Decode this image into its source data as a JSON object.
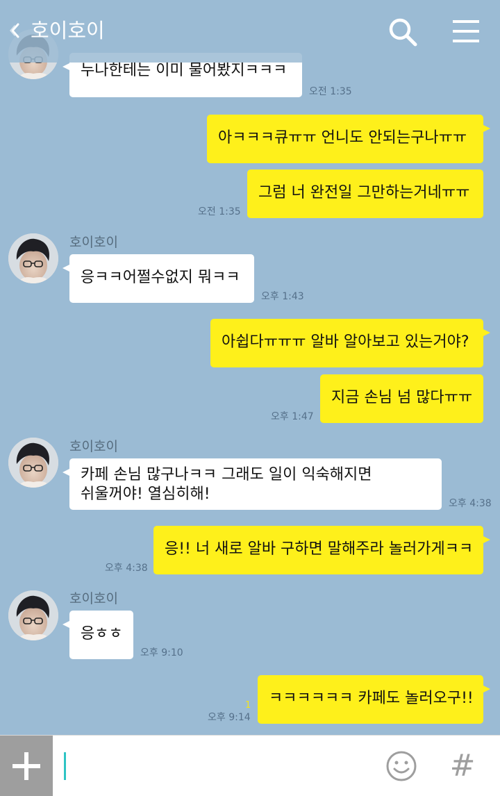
{
  "header": {
    "back_glyph": "《",
    "title": "호이호이",
    "icons": [
      "chevron-left-icon",
      "search-icon",
      "hamburger-menu-icon"
    ]
  },
  "messages": [
    {
      "from": "them",
      "sender": "",
      "text": "누나한테는 이미 물어봤지ㅋㅋㅋ",
      "time": "오전 1:35"
    },
    {
      "from": "me",
      "text": "아ㅋㅋㅋ큐ㅠㅠ 언니도 안되는구나ㅠㅠ",
      "time": ""
    },
    {
      "from": "me",
      "text": "그럼 너 완전일 그만하는거네ㅠㅠ",
      "time": "오전 1:35"
    },
    {
      "from": "them",
      "sender": "호이호이",
      "text": "응ㅋㅋ어쩔수없지 뭐ㅋㅋ",
      "time": "오후 1:43"
    },
    {
      "from": "me",
      "text": "아쉽다ㅠㅠㅠ 알바 알아보고 있는거야?",
      "time": ""
    },
    {
      "from": "me",
      "text": "지금 손님 넘 많다ㅠㅠ",
      "time": "오후 1:47"
    },
    {
      "from": "them",
      "sender": "호이호이",
      "text_lines": [
        "카페 손님 많구나ㅋㅋ 그래도 일이 익숙해지면",
        "쉬울꺼야! 열심히해!"
      ],
      "time": "오후 4:38"
    },
    {
      "from": "me",
      "text": "응!! 너 새로 알바 구하면 말해주라 놀러가게ㅋㅋ",
      "time": "오후 4:38"
    },
    {
      "from": "them",
      "sender": "호이호이",
      "text": "응ㅎㅎ",
      "time": "오후 9:10"
    },
    {
      "from": "me",
      "text": "ㅋㅋㅋㅋㅋㅋ 카페도 놀러오구!!",
      "time": "오후 9:14",
      "unread": "1"
    }
  ],
  "input_bar": {
    "plus_icon": "plus-icon",
    "text_value": "",
    "emoji_icon": "smiley-icon",
    "hash_label": "#"
  },
  "colors": {
    "background": "#9bbbd4",
    "my_bubble": "#fef01b",
    "their_bubble": "#ffffff",
    "cursor": "#2ec4c4"
  }
}
